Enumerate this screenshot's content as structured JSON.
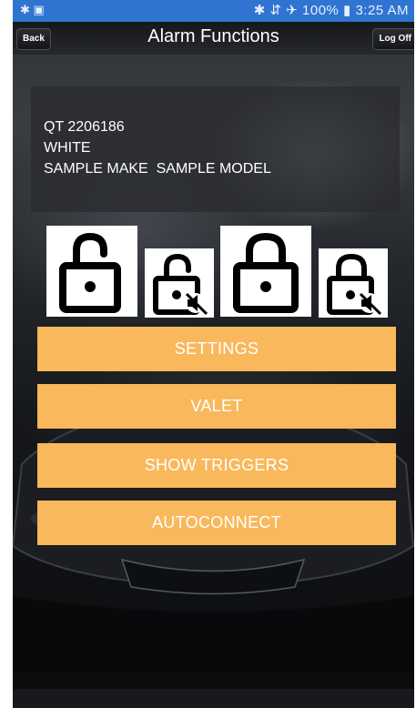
{
  "status_bar": {
    "left_icons": "✱ ▣",
    "right_text": "✱ ⇵ ✈ 100% ▮ 3:25 AM"
  },
  "header": {
    "back_label": "Back",
    "title": "Alarm Functions",
    "logoff_label": "Log Off"
  },
  "vehicle": {
    "id": "QT 2206186",
    "color": "WHITE",
    "make_model": "SAMPLE MAKE  SAMPLE MODEL"
  },
  "lock_buttons": [
    {
      "icon": "unlock-icon"
    },
    {
      "icon": "unlock-silent-icon"
    },
    {
      "icon": "lock-icon"
    },
    {
      "icon": "lock-silent-icon"
    }
  ],
  "actions": {
    "settings": "SETTINGS",
    "valet": "VALET",
    "show_triggers": "SHOW TRIGGERS",
    "autoconnect": "AUTOCONNECT"
  },
  "colors": {
    "status_bar": "#2f74d0",
    "button": "#f9b85b",
    "button_text": "#ffffff",
    "panel": "#2a2c30"
  }
}
